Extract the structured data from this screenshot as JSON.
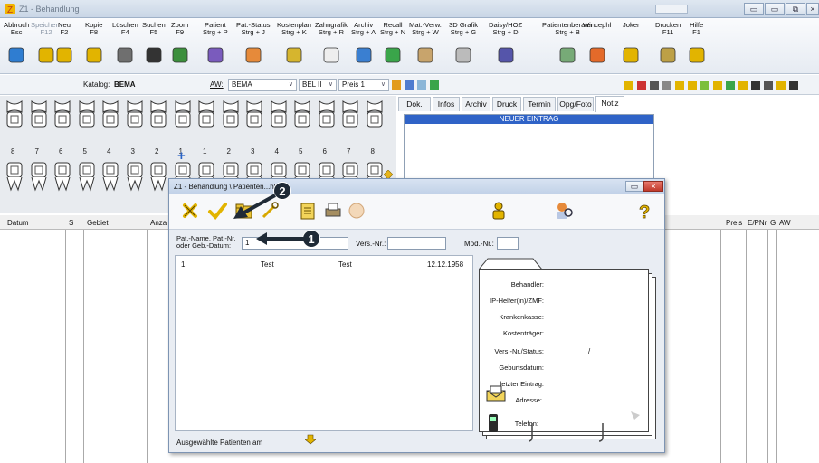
{
  "window": {
    "title": "Z1 - Behandlung"
  },
  "toolbar": {
    "items": [
      {
        "label": "Abbruch",
        "key": "Esc",
        "icon": "exit-icon",
        "disabled": false
      },
      {
        "label": "Speichern",
        "key": "F12",
        "icon": "save-icon",
        "disabled": true
      },
      {
        "label": "Neu",
        "key": "F2",
        "icon": "new-icon",
        "disabled": false
      },
      {
        "label": "Kopie",
        "key": "F8",
        "icon": "copy-icon",
        "disabled": false
      },
      {
        "label": "Löschen",
        "key": "F4",
        "icon": "trash-icon",
        "disabled": false
      },
      {
        "label": "Suchen",
        "key": "F5",
        "icon": "binoculars-icon",
        "disabled": false
      },
      {
        "label": "Zoom",
        "key": "F9",
        "icon": "zoom-icon",
        "disabled": false
      },
      {
        "label": "Patient",
        "key": "Strg + P",
        "icon": "patient-card-icon",
        "disabled": false
      },
      {
        "label": "Pat.-Status",
        "key": "Strg + J",
        "icon": "patient-status-icon",
        "disabled": false
      },
      {
        "label": "Kostenplan",
        "key": "Strg + K",
        "icon": "cost-plan-icon",
        "disabled": false
      },
      {
        "label": "Zahngrafik",
        "key": "Strg + R",
        "icon": "tooth-graphic-icon",
        "disabled": false
      },
      {
        "label": "Archiv",
        "key": "Strg + A",
        "icon": "archive-icon",
        "disabled": false
      },
      {
        "label": "Recall",
        "key": "Strg + N",
        "icon": "recall-icon",
        "disabled": false
      },
      {
        "label": "Mat.-Verw.",
        "key": "Strg + W",
        "icon": "material-icon",
        "disabled": false
      },
      {
        "label": "3D Grafik",
        "key": "Strg + G",
        "icon": "3d-graphic-icon",
        "disabled": false
      },
      {
        "label": "Daisy/HOZ",
        "key": "Strg + D",
        "icon": "daisy-icon",
        "disabled": false
      },
      {
        "label": "Patientenberater",
        "key": "Strg + B",
        "icon": "advisor-icon",
        "disabled": false
      },
      {
        "label": "Wincephl",
        "key": "",
        "icon": "winceph-icon",
        "disabled": false
      },
      {
        "label": "Joker",
        "key": "",
        "icon": "joker-icon",
        "disabled": false
      },
      {
        "label": "Drucken",
        "key": "F11",
        "icon": "printer-icon",
        "disabled": false
      },
      {
        "label": "Hilfe",
        "key": "F1",
        "icon": "help-icon",
        "disabled": false
      }
    ]
  },
  "katalog": {
    "label": "Katalog:",
    "value": "BEMA",
    "aw_label": "AW:",
    "aw_value": "BEMA",
    "bel_value": "BEL II",
    "preis_value": "Preis 1"
  },
  "teeth": {
    "upper_numbers": [
      "8",
      "7",
      "6",
      "5",
      "4",
      "3",
      "2",
      "1",
      "1",
      "2",
      "3",
      "4",
      "5",
      "6",
      "7",
      "8"
    ]
  },
  "tabs": [
    "Dok.",
    "Infos",
    "Archiv",
    "Druck",
    "Termin",
    "Opg/Foto",
    "Notiz"
  ],
  "active_tab": "Notiz",
  "notiz": {
    "entry": "NEUER EINTRAG"
  },
  "columns": {
    "left": [
      "Datum",
      "S",
      "Gebiet",
      "Anza"
    ],
    "right": [
      "Preis",
      "E/PNr",
      "G",
      "AW"
    ]
  },
  "dialog": {
    "title": "Z1 - Behandlung \\ Patienten...hl",
    "field_label_line1": "Pat.-Name, Pat.-Nr.",
    "field_label_line2": "oder Geb.-Datum:",
    "search_value": "1",
    "vers_label": "Vers.-Nr.:",
    "mod_label": "Mod.-Nr.:",
    "result": {
      "nr": "1",
      "name": "Test",
      "vorname": "Test",
      "geb": "12.12.1958"
    },
    "card_fields": [
      "Behandler:",
      "IP-Helfer(in)/ZMF:",
      "Krankenkasse:",
      "Kostenträger:",
      "Vers.-Nr./Status:",
      "Geburtsdatum:",
      "letzter Eintrag:",
      "Adresse:",
      "Telefon:"
    ],
    "status_separator": "/",
    "bottom_text": "Ausgewählte Patienten am"
  },
  "callouts": {
    "one": "1",
    "two": "2"
  },
  "colors": {
    "accent": "#2f63c7",
    "callout": "#1f2a36",
    "icon_yellow": "#f2c200"
  }
}
